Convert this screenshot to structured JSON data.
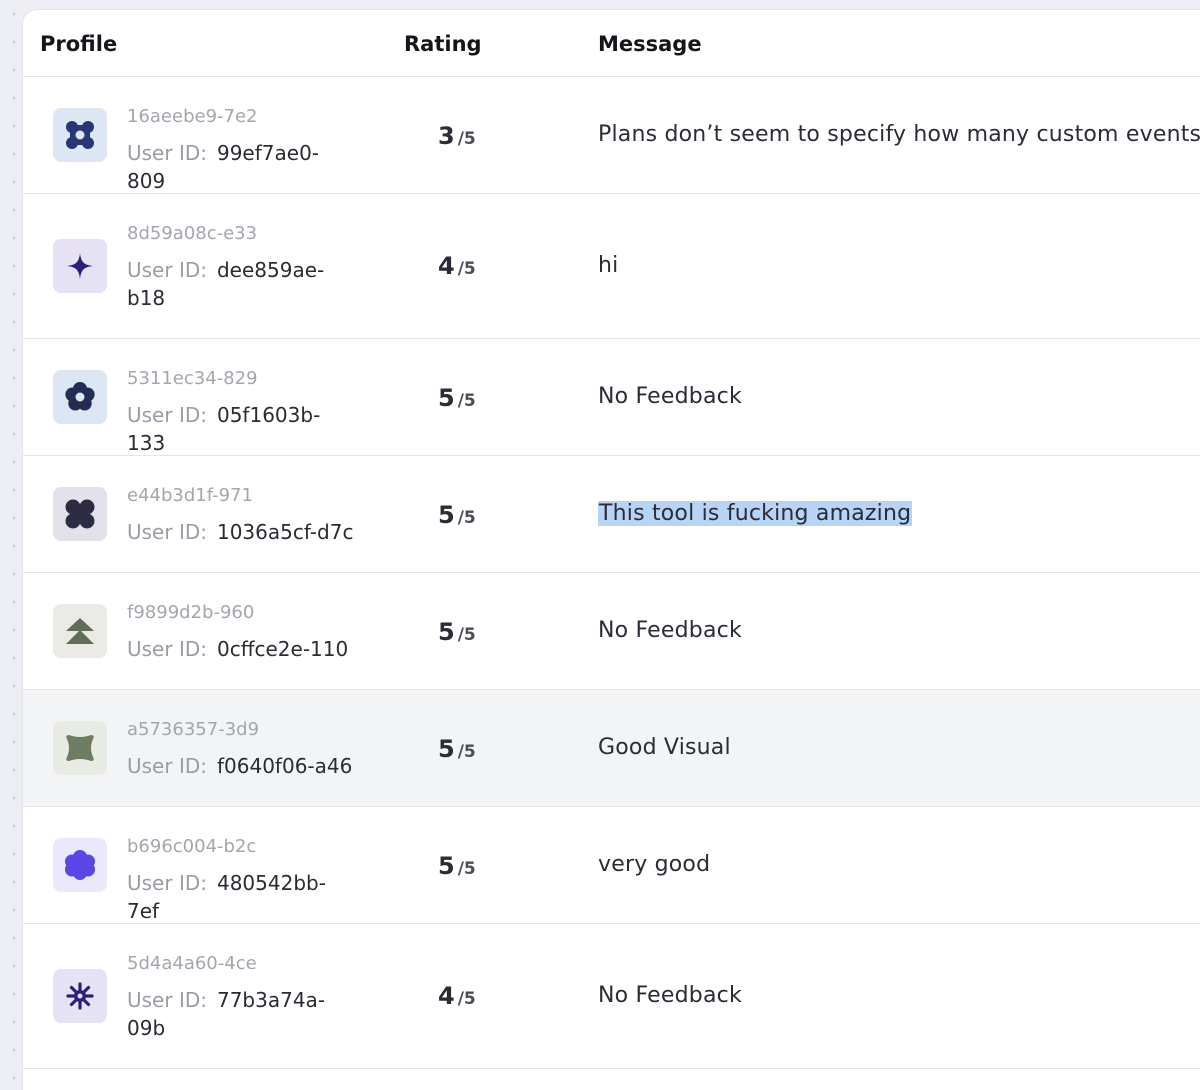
{
  "table": {
    "columns": {
      "profile": "Profile",
      "rating": "Rating",
      "message": "Message"
    },
    "user_id_label": "User ID:",
    "rating_max": "/5",
    "rows": [
      {
        "profile_id": "16aeebe9-7e2",
        "user_id": "99ef7ae0-809",
        "rating": "3",
        "message": "Plans don’t seem to specify how many custom events",
        "icon": "rounded-square-icon",
        "icon_color": "#2a3577",
        "icon_bg": "#dde6f3"
      },
      {
        "profile_id": "8d59a08c-e33",
        "user_id": "dee859ae-b18",
        "rating": "4",
        "message": "hi",
        "icon": "sparkle-icon",
        "icon_color": "#2c1f78",
        "icon_bg": "#e6e2f3"
      },
      {
        "profile_id": "5311ec34-829",
        "user_id": "05f1603b-133",
        "rating": "5",
        "message": "No Feedback",
        "icon": "flower-ring-icon",
        "icon_color": "#232d52",
        "icon_bg": "#dde6f3"
      },
      {
        "profile_id": "e44b3d1f-971",
        "user_id": "1036a5cf-d7c",
        "rating": "5",
        "message": "This tool is fucking amazing",
        "selected": true,
        "icon": "four-petal-icon",
        "icon_color": "#2b2c44",
        "icon_bg": "#e4e1ea"
      },
      {
        "profile_id": "f9899d2b-960",
        "user_id": "0cffce2e-110",
        "rating": "5",
        "message": "No Feedback",
        "icon": "chevrons-up-icon",
        "icon_color": "#5f6e55",
        "icon_bg": "#eaebe6"
      },
      {
        "profile_id": "a5736357-3d9",
        "user_id": "f0640f06-a46",
        "rating": "5",
        "message": "Good Visual",
        "hover": true,
        "icon": "pillow-square-icon",
        "icon_color": "#6d7d60",
        "icon_bg": "#e8eae4"
      },
      {
        "profile_id": "b696c004-b2c",
        "user_id": "480542bb-7ef",
        "rating": "5",
        "message": "very good",
        "icon": "flower-icon",
        "icon_color": "#5a45e6",
        "icon_bg": "#ebe8fb"
      },
      {
        "profile_id": "5d4a4a60-4ce",
        "user_id": "77b3a74a-09b",
        "rating": "4",
        "message": "No Feedback",
        "icon": "starburst-icon",
        "icon_color": "#2c1f78",
        "icon_bg": "#e6e2f3"
      }
    ]
  }
}
